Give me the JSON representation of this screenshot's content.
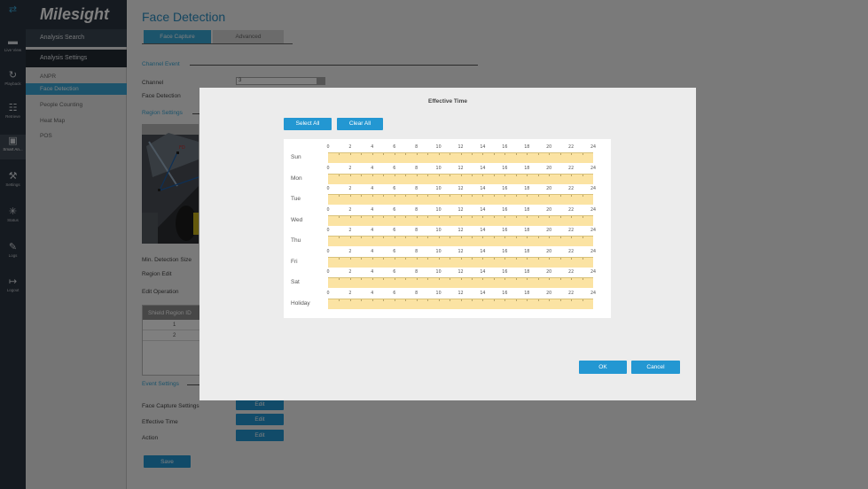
{
  "rail": [
    {
      "icon": "arrows-icon",
      "label": ""
    },
    {
      "icon": "camera-icon",
      "label": "Live View"
    },
    {
      "icon": "playback-icon",
      "label": "Playback"
    },
    {
      "icon": "retrieve-icon",
      "label": "Retrieve"
    },
    {
      "icon": "smart-analysis-icon",
      "label": "Smart An..."
    },
    {
      "icon": "settings-tools-icon",
      "label": "Settings"
    },
    {
      "icon": "status-icon",
      "label": "Status"
    },
    {
      "icon": "logs-icon",
      "label": "Logs"
    },
    {
      "icon": "logout-icon",
      "label": "Logout"
    }
  ],
  "menu": {
    "logo": "Milesight",
    "analysis_search": "Analysis Search",
    "analysis_settings": "Analysis Settings",
    "items": [
      "ANPR",
      "Face Detection",
      "People Counting",
      "Heat Map",
      "POS"
    ]
  },
  "main": {
    "title": "Face Detection",
    "tabs": [
      "Face Capture",
      "Advanced"
    ],
    "channel_event": "Channel Event",
    "channel_label": "Channel",
    "channel_value": "3",
    "face_detection_label": "Face Detection",
    "region_settings": "Region Settings",
    "min_detection_size": "Min. Detection Size",
    "region_edit": "Region Edit",
    "edit_operation": "Edit Operation",
    "shield_header": "Shield Region ID",
    "shield_rows": [
      "1",
      "2"
    ],
    "event_settings": "Event Settings",
    "face_capture_settings": "Face Capture Settings",
    "effective_time": "Effective Time",
    "action": "Action",
    "edit_label": "Edit",
    "save_label": "Save"
  },
  "dialog": {
    "title": "Effective Time",
    "select_all": "Select All",
    "clear_all": "Clear All",
    "ticks": [
      "0",
      "2",
      "4",
      "6",
      "8",
      "10",
      "12",
      "14",
      "16",
      "18",
      "20",
      "22",
      "24"
    ],
    "days": [
      "Sun",
      "Mon",
      "Tue",
      "Wed",
      "Thu",
      "Fri",
      "Sat",
      "Holiday"
    ],
    "ok": "OK",
    "cancel": "Cancel"
  },
  "colors": {
    "accent": "#2397d2",
    "schedule_fill": "#fbe3a3",
    "rail_bg": "#2b3440"
  }
}
